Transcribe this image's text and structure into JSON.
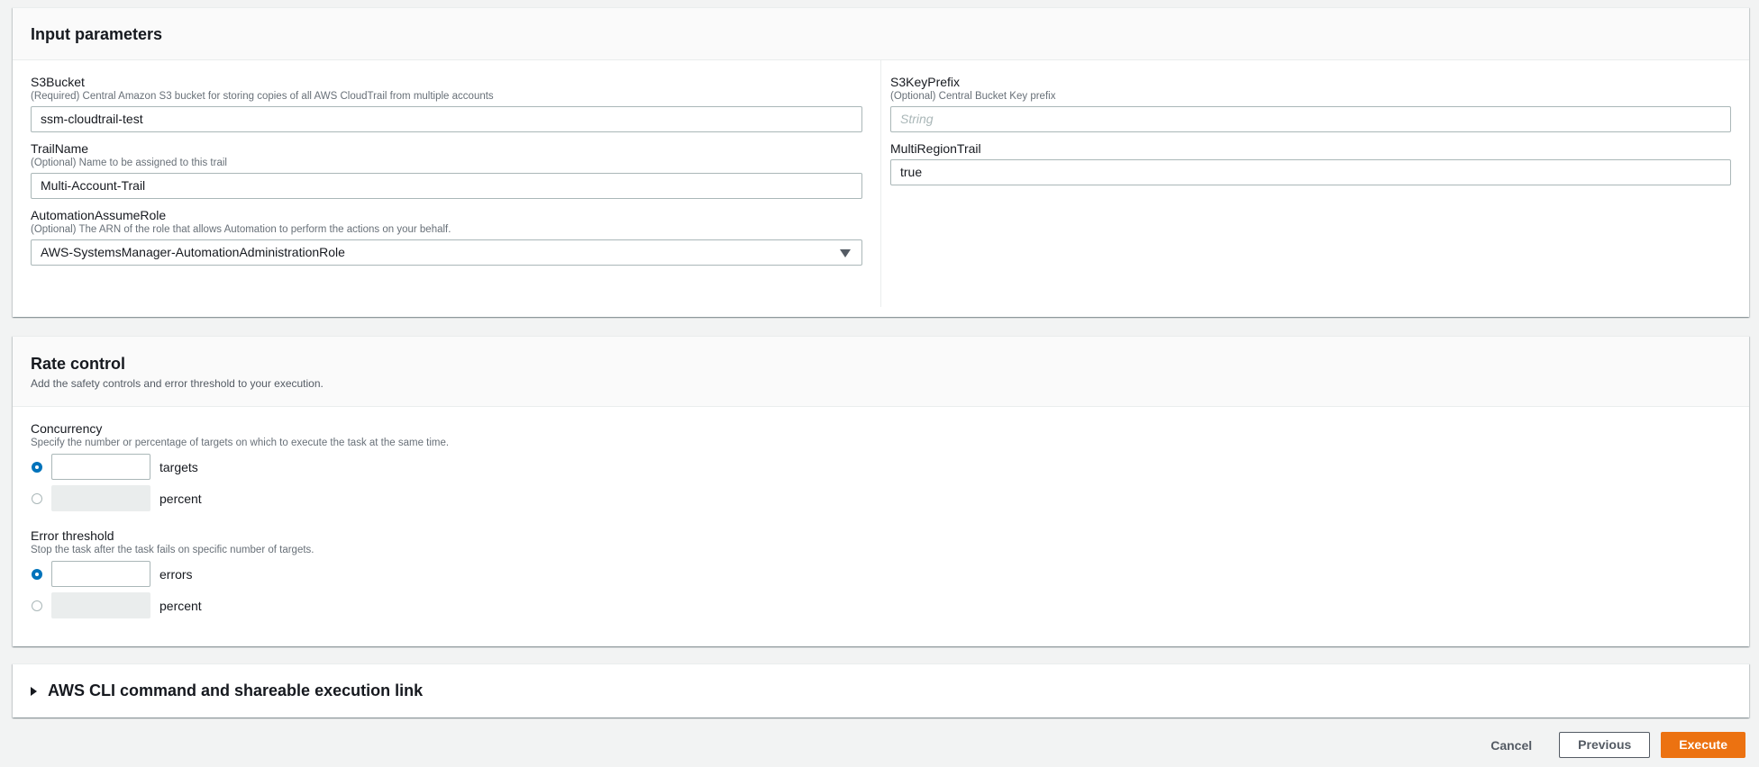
{
  "input_parameters": {
    "title": "Input parameters",
    "s3bucket": {
      "label": "S3Bucket",
      "description": "(Required) Central Amazon S3 bucket for storing copies of all AWS CloudTrail from multiple accounts",
      "value": "ssm-cloudtrail-test"
    },
    "trailname": {
      "label": "TrailName",
      "description": "(Optional) Name to be assigned to this trail",
      "value": "Multi-Account-Trail"
    },
    "automation_assume_role": {
      "label": "AutomationAssumeRole",
      "description": "(Optional) The ARN of the role that allows Automation to perform the actions on your behalf.",
      "value": "AWS-SystemsManager-AutomationAdministrationRole"
    },
    "s3keyprefix": {
      "label": "S3KeyPrefix",
      "description": "(Optional) Central Bucket Key prefix",
      "placeholder": "String"
    },
    "multiregiontrail": {
      "label": "MultiRegionTrail",
      "value": "true"
    }
  },
  "rate_control": {
    "title": "Rate control",
    "description": "Add the safety controls and error threshold to your execution.",
    "concurrency": {
      "label": "Concurrency",
      "description": "Specify the number or percentage of targets on which to execute the task at the same time.",
      "options": [
        {
          "unit": "targets",
          "selected": true,
          "value": ""
        },
        {
          "unit": "percent",
          "selected": false,
          "value": ""
        }
      ]
    },
    "error_threshold": {
      "label": "Error threshold",
      "description": "Stop the task after the task fails on specific number of targets.",
      "options": [
        {
          "unit": "errors",
          "selected": true,
          "value": ""
        },
        {
          "unit": "percent",
          "selected": false,
          "value": ""
        }
      ]
    }
  },
  "cli_section": {
    "title": "AWS CLI command and shareable execution link"
  },
  "footer": {
    "cancel_label": "Cancel",
    "previous_label": "Previous",
    "execute_label": "Execute"
  },
  "colors": {
    "accent": "#0073bb",
    "primary_button": "#ec7211",
    "background": "#f2f3f3"
  }
}
